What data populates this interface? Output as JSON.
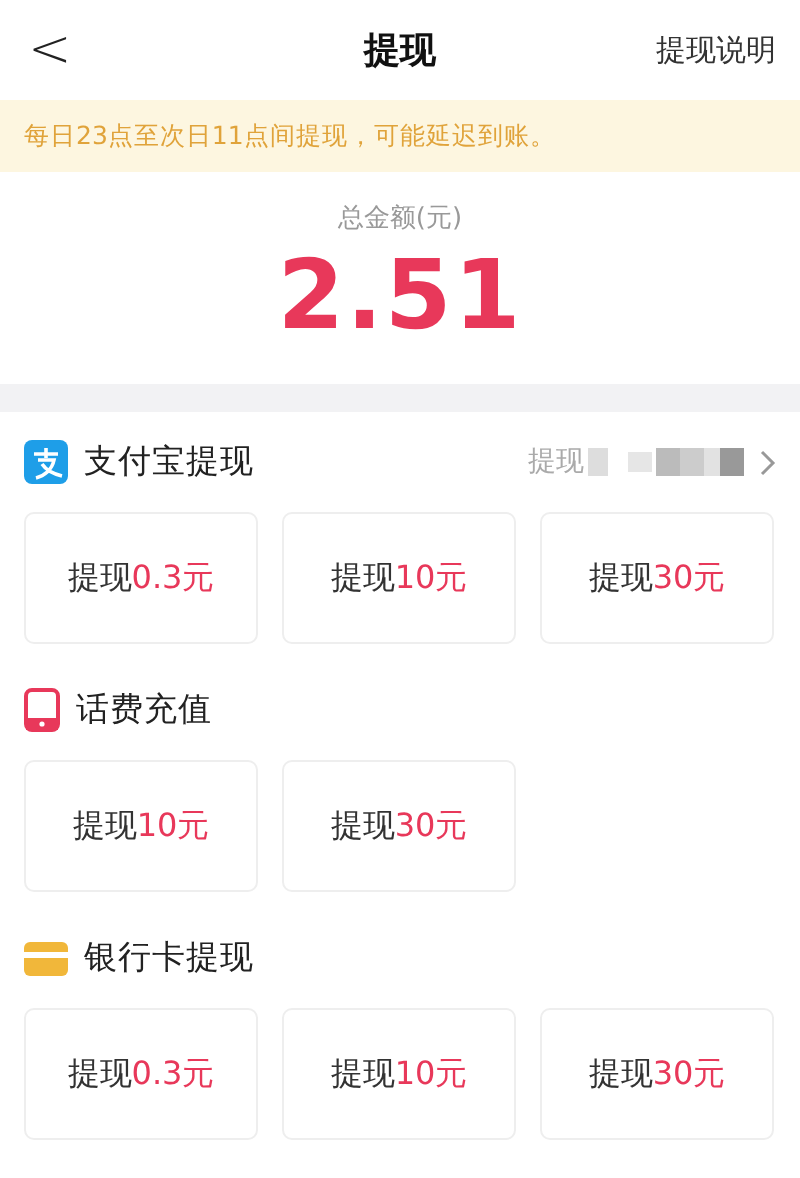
{
  "header": {
    "back": "<",
    "title": "提现",
    "link": "提现说明"
  },
  "notice": "每日23点至次日11点间提现，可能延迟到账。",
  "total": {
    "label": "总金额(元)",
    "amount": "2.51"
  },
  "sections": [
    {
      "kind": "alipay",
      "title": "支付宝提现",
      "account": "提现",
      "options": [
        {
          "prefix": "提现",
          "amount": "0.3元"
        },
        {
          "prefix": "提现",
          "amount": "10元"
        },
        {
          "prefix": "提现",
          "amount": "30元"
        }
      ]
    },
    {
      "kind": "phone",
      "title": "话费充值",
      "options": [
        {
          "prefix": "提现",
          "amount": "10元"
        },
        {
          "prefix": "提现",
          "amount": "30元"
        }
      ]
    },
    {
      "kind": "bank",
      "title": "银行卡提现",
      "options": [
        {
          "prefix": "提现",
          "amount": "0.3元"
        },
        {
          "prefix": "提现",
          "amount": "10元"
        },
        {
          "prefix": "提现",
          "amount": "30元"
        }
      ]
    }
  ]
}
